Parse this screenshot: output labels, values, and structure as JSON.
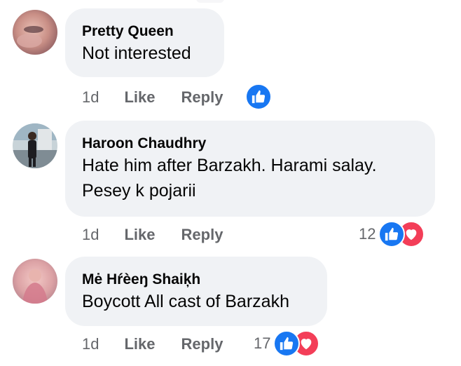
{
  "comments": [
    {
      "author": "Pretty Queen",
      "text_lines": [
        "Not interested"
      ],
      "time": "1d",
      "like_label": "Like",
      "reply_label": "Reply",
      "reaction_count": "",
      "reactions": [
        "like-icon"
      ]
    },
    {
      "author": "Haroon Chaudhry",
      "text_lines": [
        "Hate him after Barzakh. Harami salay.",
        "Pesey k pojarii"
      ],
      "time": "1d",
      "like_label": "Like",
      "reply_label": "Reply",
      "reaction_count": "12",
      "reactions": [
        "like-icon",
        "love-icon"
      ]
    },
    {
      "author": "Mė Hŕèeŋ Shaiķh",
      "text_lines": [
        "Boycott All cast of Barzakh"
      ],
      "time": "1d",
      "like_label": "Like",
      "reply_label": "Reply",
      "reaction_count": "17",
      "reactions": [
        "like-icon",
        "love-icon"
      ]
    }
  ],
  "colors": {
    "bubble": "#f0f2f5",
    "meta_text": "#65676b",
    "like_blue": "#1877f2",
    "love_red": "#f33e58"
  }
}
